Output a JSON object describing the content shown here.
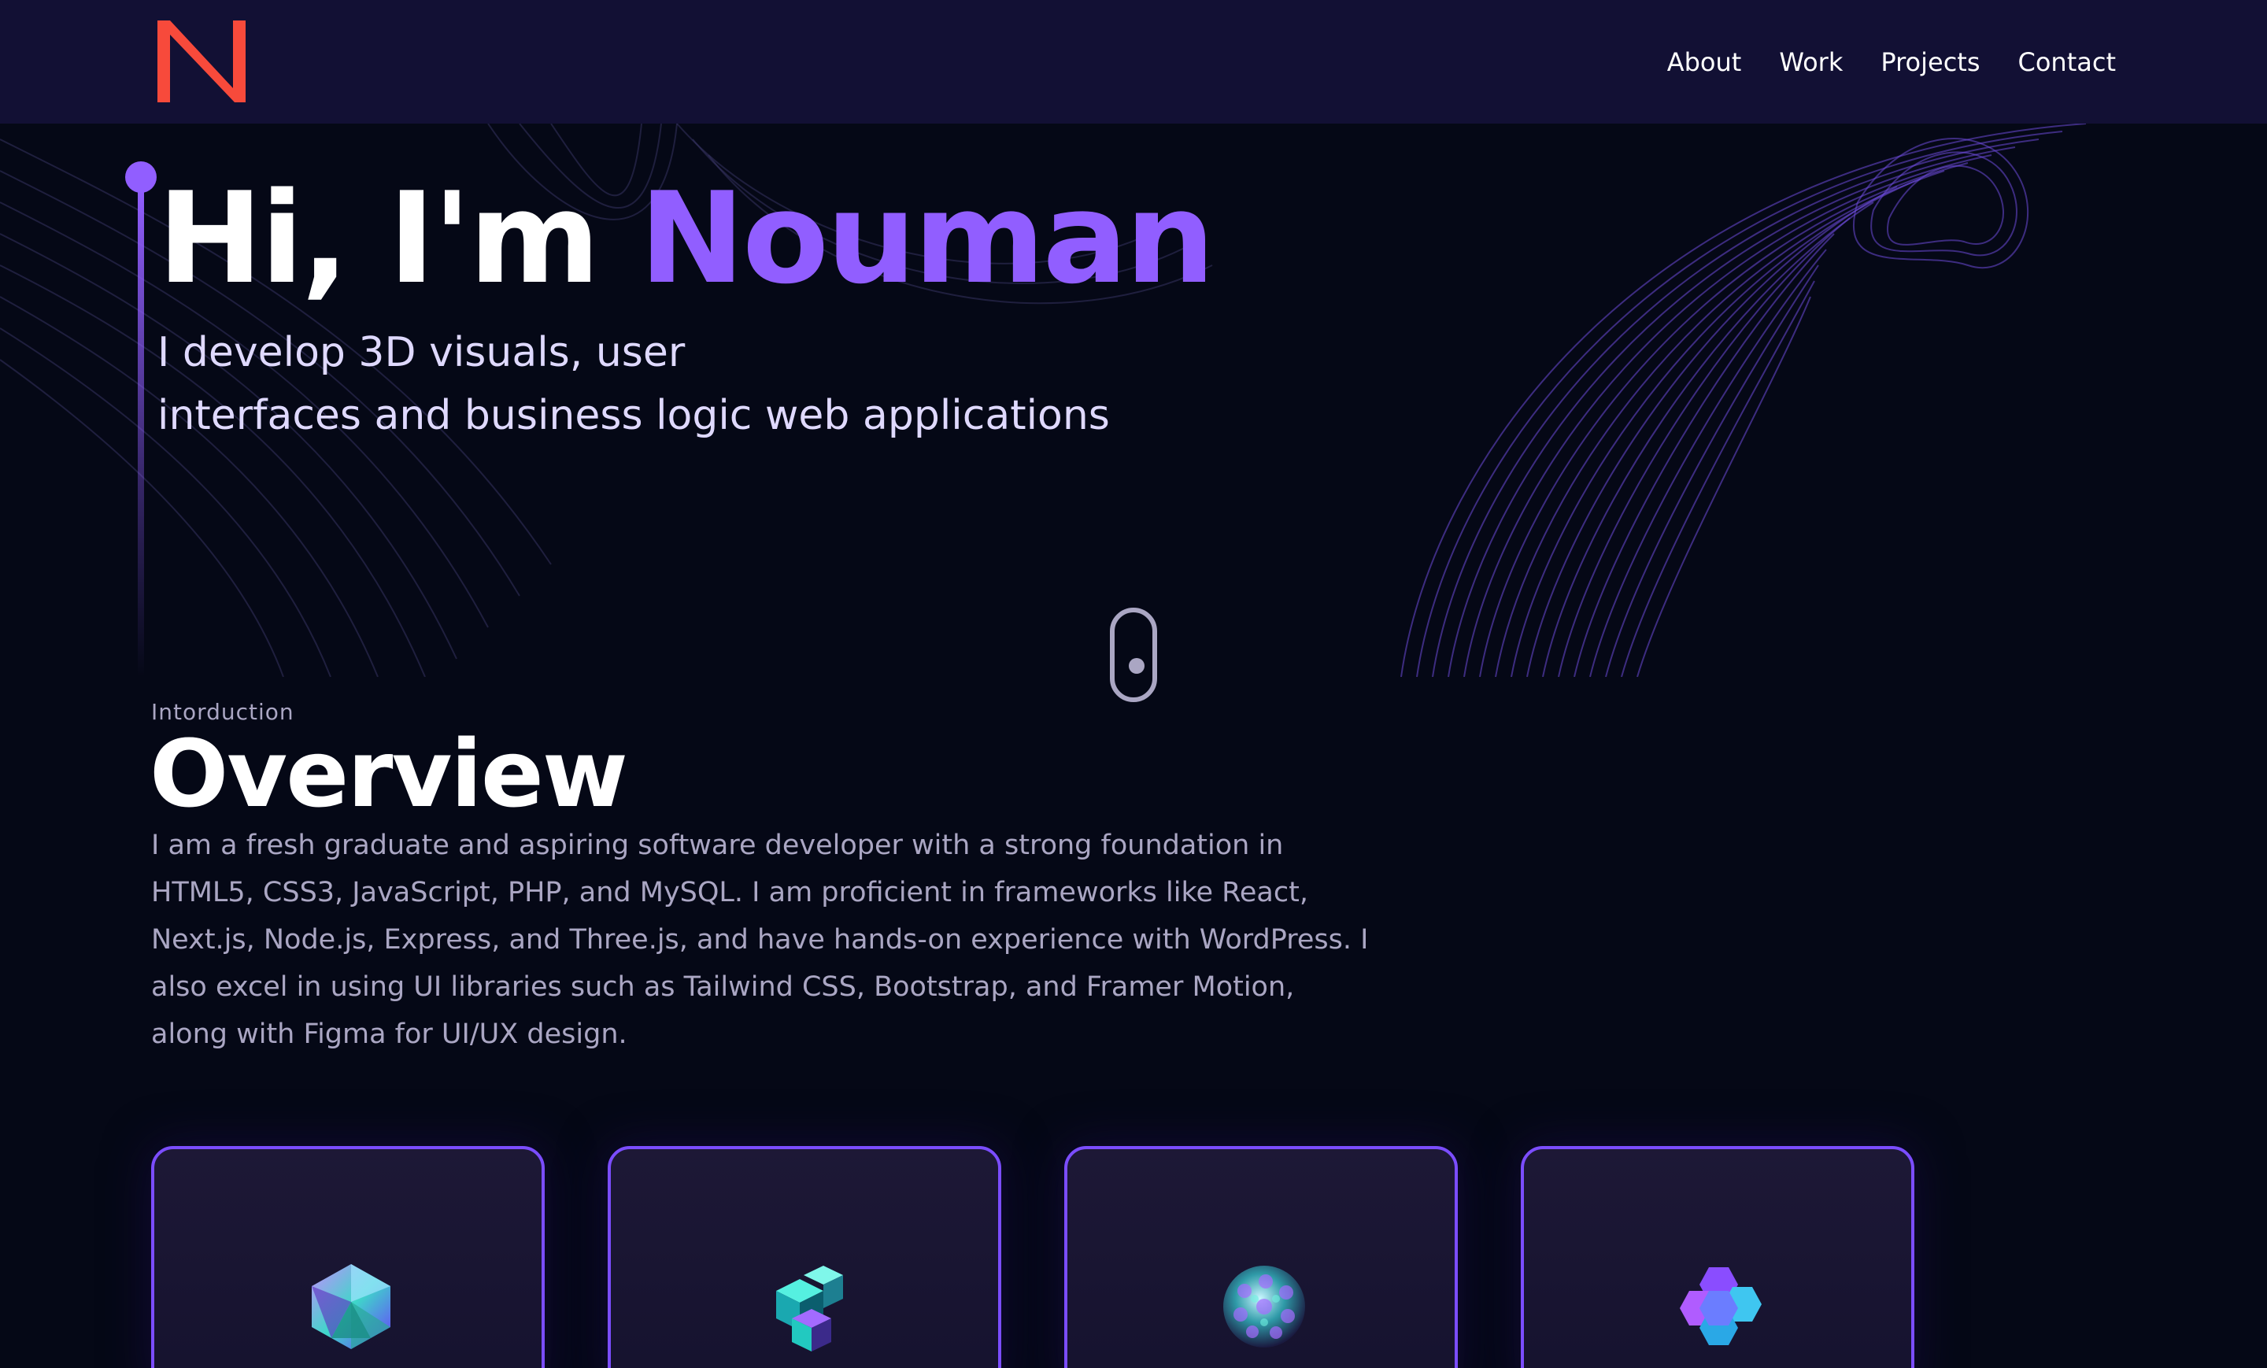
{
  "navbar": {
    "logo_text": "N",
    "links": [
      {
        "label": "About"
      },
      {
        "label": "Work"
      },
      {
        "label": "Projects"
      },
      {
        "label": "Contact"
      }
    ]
  },
  "hero": {
    "greeting": "Hi, I'm",
    "name": "Nouman",
    "subtitle_line1": "I develop 3D visuals, user",
    "subtitle_line2": "interfaces and business logic web applications"
  },
  "overview": {
    "label": "Intorduction",
    "title": "Overview",
    "text": "I am a fresh graduate and aspiring software developer with a strong foundation in HTML5, CSS3, JavaScript, PHP, and MySQL. I am proficient in frameworks like React, Next.js, Node.js, Express, and Three.js, and have hands-on experience with WordPress. I also excel in using UI libraries such as Tailwind CSS, Bootstrap, and Framer Motion, along with Figma for UI/UX design."
  },
  "cards": [
    {
      "icon": "icosahedron-icon"
    },
    {
      "icon": "cube-cluster-icon"
    },
    {
      "icon": "sphere-icon"
    },
    {
      "icon": "hex-cluster-icon"
    }
  ],
  "colors": {
    "background": "#050816",
    "navbar": "#121034",
    "accent": "#915eff",
    "logo": "#f74a3b",
    "secondary_text": "#aaa6c3"
  }
}
